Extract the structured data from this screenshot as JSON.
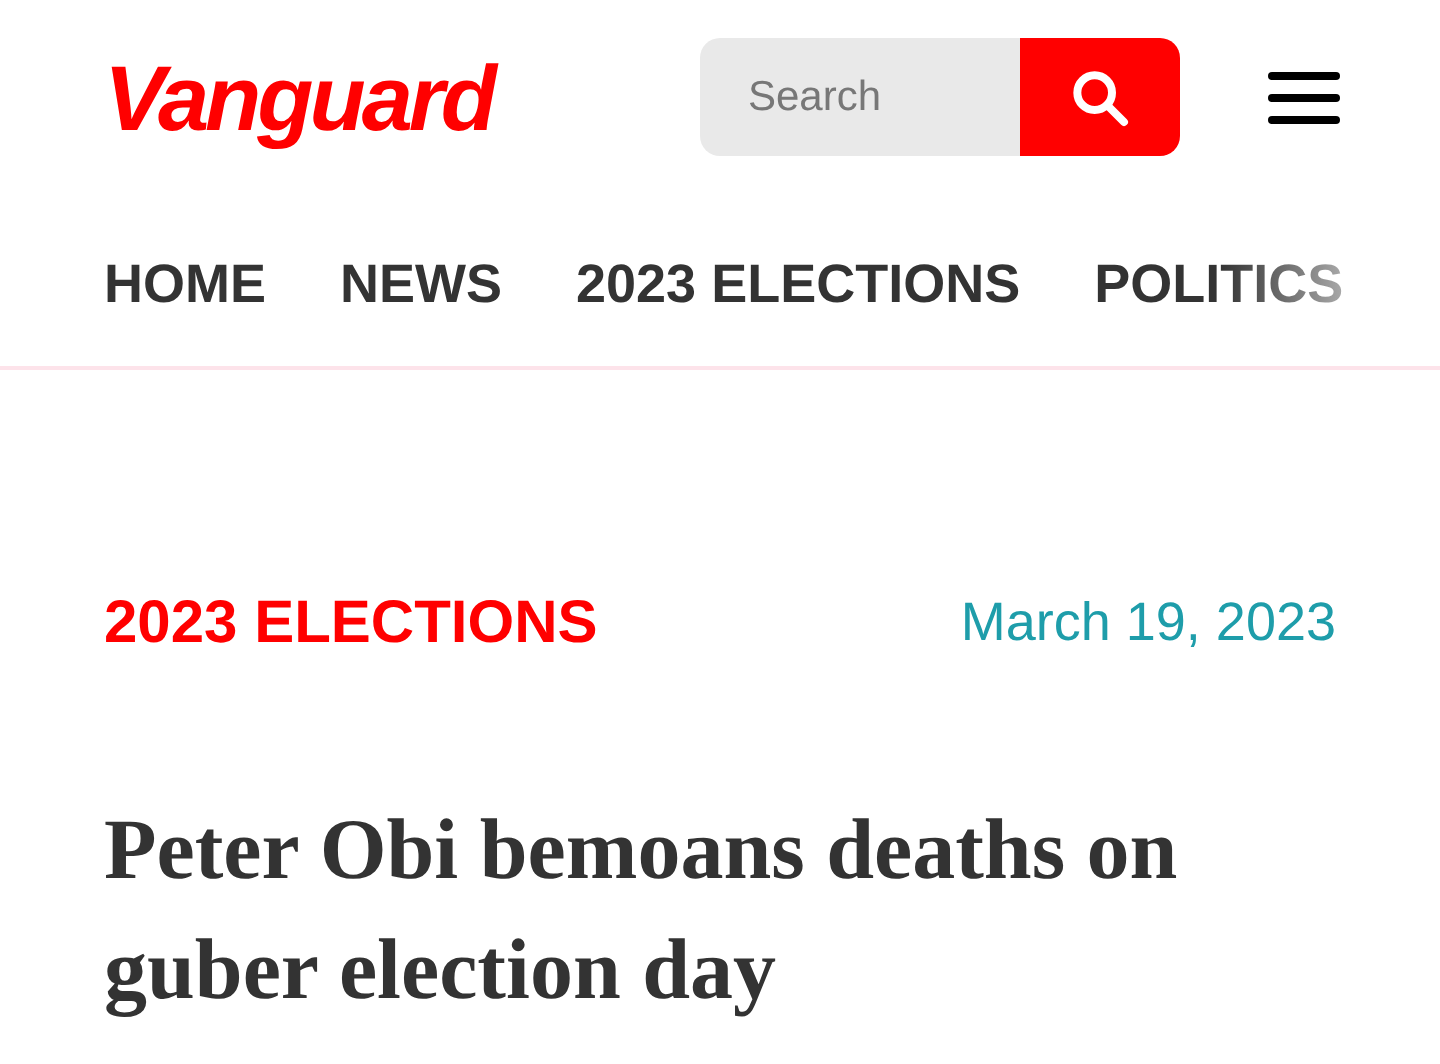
{
  "header": {
    "logo": "Vanguard",
    "search": {
      "placeholder": "Search"
    }
  },
  "nav": [
    {
      "label": "HOME",
      "faded": false
    },
    {
      "label": "NEWS",
      "faded": false
    },
    {
      "label": "2023 ELECTIONS",
      "faded": false
    },
    {
      "label": "POLITICS",
      "faded": true
    }
  ],
  "article": {
    "category": "2023 ELECTIONS",
    "date": "March 19, 2023",
    "headline": "Peter Obi bemoans deaths on guber election day"
  }
}
